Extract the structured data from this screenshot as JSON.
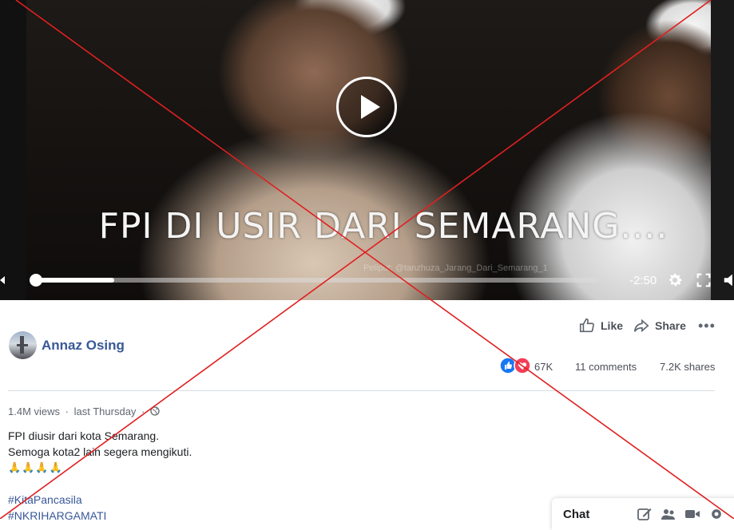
{
  "video": {
    "caption": "FPI DI USIR DARI SEMARANG....",
    "watermark": "Peliput: @tanzhuza_Jarang_Dari_Semarang_1",
    "time_remaining": "-2:50",
    "progress_fraction": 0.14
  },
  "post": {
    "author": "Annaz Osing",
    "actions": {
      "like": "Like",
      "share": "Share",
      "more": "•••"
    },
    "stats": {
      "reactions": "67K",
      "comments": "11 comments",
      "shares": "7.2K shares"
    },
    "meta": {
      "views": "1.4M views",
      "separator": "·",
      "time": "last Thursday",
      "audience_icon": "globe-icon"
    },
    "text_lines": [
      "FPI diusir dari kota Semarang.",
      "Semoga kota2 lain segera mengikuti."
    ],
    "emoji_line": "🙏🙏🙏🙏",
    "hashtags": [
      "#KitaPancasila",
      "#NKRIHARGAMATI"
    ]
  },
  "chat": {
    "label": "Chat"
  },
  "overlay": {
    "color": "#e02020"
  },
  "colors": {
    "link": "#385898",
    "like_blue": "#1877f2",
    "love_red": "#f33e58"
  }
}
